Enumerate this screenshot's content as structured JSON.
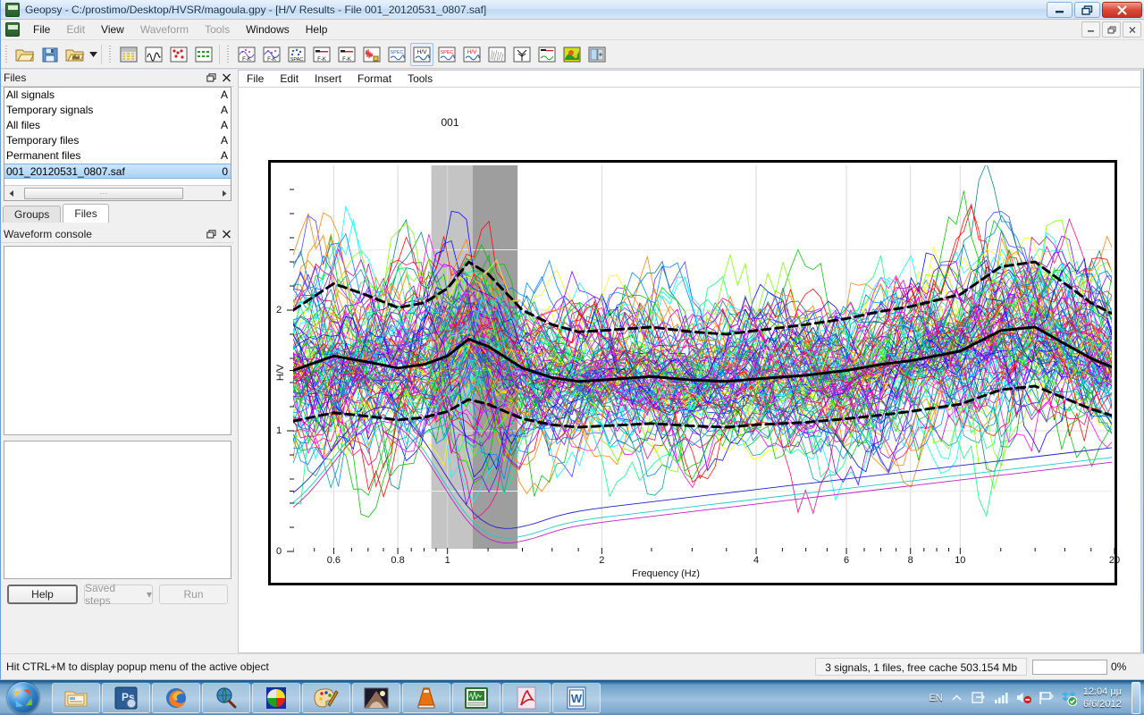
{
  "window": {
    "title": "Geopsy - C:/prostimo/Desktop/HVSR/magoula.gpy - [H/V Results - File 001_20120531_0807.saf]",
    "title_full": "Geopsy - C:/prostimo/Desktop/HVSR/magoula.gpy - [H/V Results - File 001_20120531_0807.saf]",
    "app_icon": "geopsy-icon",
    "minimize": "–",
    "maximize": "❐",
    "close": "✕",
    "mdi_minimize": "–",
    "mdi_restore": "❐",
    "mdi_close": "✕"
  },
  "menubar": {
    "items": [
      {
        "label": "File",
        "enabled": true
      },
      {
        "label": "Edit",
        "enabled": false
      },
      {
        "label": "View",
        "enabled": true
      },
      {
        "label": "Waveform",
        "enabled": false
      },
      {
        "label": "Tools",
        "enabled": false
      },
      {
        "label": "Windows",
        "enabled": true
      },
      {
        "label": "Help",
        "enabled": true
      }
    ]
  },
  "toolbar": {
    "groups": [
      [
        "open-file-icon",
        "save-file-icon",
        "open-waveform-icon",
        "dropdown-arrow-icon"
      ],
      [
        "table-icon",
        "signal-plot-icon",
        "picks-icon",
        "array-icon"
      ],
      [
        "fk-icon",
        "fk-rings-icon",
        "spac-icon",
        "fk-slant-icon",
        "fk-vertical-icon",
        "waveform-spectrum-icon",
        "spec-icon",
        "hv-icon",
        "spec-red-icon",
        "hv-red-icon",
        "noise-icon",
        "tree-icon",
        "profile-icon",
        "dispersion-map-icon",
        "report-icon"
      ]
    ],
    "active_tool": "hv-icon"
  },
  "files_panel": {
    "title": "Files",
    "float_btn": "restore-icon",
    "close_btn": "close-icon",
    "rows": [
      {
        "name": "All signals",
        "col2": "A"
      },
      {
        "name": "Temporary signals",
        "col2": "A"
      },
      {
        "name": "All files",
        "col2": "A"
      },
      {
        "name": "Temporary files",
        "col2": "A"
      },
      {
        "name": "Permanent files",
        "col2": "A"
      },
      {
        "name": "001_20120531_0807.saf",
        "col2": "0",
        "selected": true
      }
    ],
    "tabs": [
      {
        "label": "Groups",
        "active": false
      },
      {
        "label": "Files",
        "active": true
      }
    ],
    "scroll_thumb": "⋯"
  },
  "console_panel": {
    "title": "Waveform console",
    "float_btn": "restore-icon",
    "close_btn": "close-icon",
    "buttons": {
      "help": "Help",
      "saved_steps": "Saved steps",
      "saved_steps_arrow": "▾",
      "run": "Run"
    }
  },
  "chart_window": {
    "menubar": [
      {
        "label": "File"
      },
      {
        "label": "Edit"
      },
      {
        "label": "Insert"
      },
      {
        "label": "Format"
      },
      {
        "label": "Tools"
      }
    ]
  },
  "chart_data": {
    "type": "line",
    "title": "001",
    "xlabel": "Frequency (Hz)",
    "ylabel": "H/V",
    "xscale": "log",
    "yscale": "linear",
    "xlim": [
      0.5,
      20
    ],
    "ylim": [
      0,
      3.2
    ],
    "grid": true,
    "legend": "none",
    "xticks": [
      {
        "value": 0.6,
        "label": "0.6"
      },
      {
        "value": 0.8,
        "label": "0.8"
      },
      {
        "value": 1,
        "label": "1"
      },
      {
        "value": 2,
        "label": "2"
      },
      {
        "value": 4,
        "label": "4"
      },
      {
        "value": 6,
        "label": "6"
      },
      {
        "value": 8,
        "label": "8"
      },
      {
        "value": 10,
        "label": "10"
      },
      {
        "value": 20,
        "label": "20"
      }
    ],
    "yticks": [
      {
        "value": 0,
        "label": "0"
      },
      {
        "value": 1,
        "label": "1"
      },
      {
        "value": 2,
        "label": "2"
      }
    ],
    "shaded_bands": [
      {
        "name": "f0-light-band",
        "from": 0.93,
        "to": 1.12,
        "color": "#c4c4c4"
      },
      {
        "name": "f0-dark-band",
        "from": 1.12,
        "to": 1.37,
        "color": "#9e9e9e"
      }
    ],
    "series": [
      {
        "name": "mean-hv",
        "style": "solid-black",
        "color": "#000000",
        "x": [
          0.5,
          0.6,
          0.7,
          0.8,
          0.9,
          1.0,
          1.1,
          1.2,
          1.4,
          1.6,
          1.8,
          2.0,
          2.5,
          3.0,
          3.5,
          4.0,
          5.0,
          6.0,
          7.0,
          8.0,
          10.0,
          12.0,
          14.0,
          16.0,
          18.0,
          20.0
        ],
        "y": [
          1.5,
          1.62,
          1.57,
          1.52,
          1.55,
          1.62,
          1.76,
          1.7,
          1.52,
          1.44,
          1.41,
          1.42,
          1.45,
          1.42,
          1.41,
          1.43,
          1.46,
          1.5,
          1.55,
          1.58,
          1.66,
          1.83,
          1.86,
          1.72,
          1.6,
          1.52
        ]
      },
      {
        "name": "mean-plus-stddev",
        "style": "dashed-black",
        "color": "#000000",
        "x": [
          0.5,
          0.6,
          0.7,
          0.8,
          0.9,
          1.0,
          1.1,
          1.2,
          1.4,
          1.6,
          1.8,
          2.0,
          2.5,
          3.0,
          3.5,
          4.0,
          5.0,
          6.0,
          7.0,
          8.0,
          10.0,
          12.0,
          14.0,
          16.0,
          18.0,
          20.0
        ],
        "y": [
          2.0,
          2.22,
          2.12,
          2.02,
          2.06,
          2.18,
          2.4,
          2.3,
          2.0,
          1.88,
          1.82,
          1.83,
          1.86,
          1.82,
          1.8,
          1.83,
          1.88,
          1.93,
          1.99,
          2.03,
          2.13,
          2.36,
          2.4,
          2.22,
          2.06,
          1.96
        ]
      },
      {
        "name": "mean-minus-stddev",
        "style": "dashed-black",
        "color": "#000000",
        "x": [
          0.5,
          0.6,
          0.7,
          0.8,
          0.9,
          1.0,
          1.1,
          1.2,
          1.4,
          1.6,
          1.8,
          2.0,
          2.5,
          3.0,
          3.5,
          4.0,
          5.0,
          6.0,
          7.0,
          8.0,
          10.0,
          12.0,
          14.0,
          16.0,
          18.0,
          20.0
        ],
        "y": [
          1.08,
          1.15,
          1.12,
          1.09,
          1.11,
          1.16,
          1.26,
          1.22,
          1.1,
          1.05,
          1.03,
          1.04,
          1.06,
          1.04,
          1.03,
          1.05,
          1.07,
          1.1,
          1.13,
          1.16,
          1.22,
          1.34,
          1.37,
          1.27,
          1.18,
          1.12
        ]
      }
    ],
    "window_count": 120,
    "window_colors": [
      "#ff00ff",
      "#0000ff",
      "#00ffff",
      "#00c000",
      "#ff8000",
      "#ff0000",
      "#c000c0",
      "#0080ff",
      "#80ff00",
      "#ffff00",
      "#008080",
      "#8000ff",
      "#00ff80",
      "#ff0080",
      "#4040ff",
      "#00a0a0"
    ]
  },
  "statusbar": {
    "hint": "Hit CTRL+M to display popup menu of the active object",
    "info": "3 signals, 1 files, free cache 503.154 Mb",
    "progress_value": 0,
    "progress_label": "0%"
  },
  "taskbar": {
    "start": "start-orb-icon",
    "items": [
      {
        "name": "explorer-icon",
        "active": true
      },
      {
        "name": "photoshop-icon",
        "active": false
      },
      {
        "name": "firefox-icon",
        "active": false
      },
      {
        "name": "magnifier-globe-icon",
        "active": false
      },
      {
        "name": "color-pie-icon",
        "active": false
      },
      {
        "name": "paint-palette-icon",
        "active": false
      },
      {
        "name": "picture-icon",
        "active": false
      },
      {
        "name": "vlc-cone-icon",
        "active": false
      },
      {
        "name": "geopsy-icon",
        "active": true
      },
      {
        "name": "adobe-reader-icon",
        "active": true
      },
      {
        "name": "word-icon",
        "active": true
      }
    ],
    "tray": {
      "language": "EN",
      "show_hidden": "show-hidden-icons-icon",
      "icons": [
        "bluetooth-device-icon",
        "network-signal-icon",
        "volume-muted-icon",
        "action-center-flag-icon",
        "dropbox-icon"
      ],
      "time": "12:04 μμ",
      "date": "6/6/2012"
    }
  }
}
